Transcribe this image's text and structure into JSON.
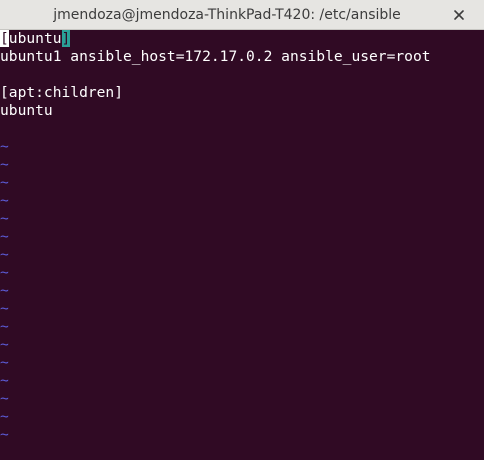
{
  "window": {
    "title": "jmendoza@jmendoza-ThinkPad-T420: /etc/ansible",
    "close_icon": "close-icon"
  },
  "editor": {
    "lines": [
      {
        "cursor_char": "[",
        "text": "ubuntu",
        "bracket": "]"
      },
      {
        "text": "ubuntu1 ansible_host=172.17.0.2 ansible_user=root"
      },
      {
        "text": ""
      },
      {
        "text": "[apt:children]"
      },
      {
        "text": "ubuntu"
      },
      {
        "text": ""
      }
    ],
    "empty_line_marker": "~",
    "empty_line_count": 17
  },
  "colors": {
    "background": "#300a24",
    "text": "#ffffff",
    "tilde": "#5b5bd6",
    "bracket_highlight": "#2aa198"
  }
}
